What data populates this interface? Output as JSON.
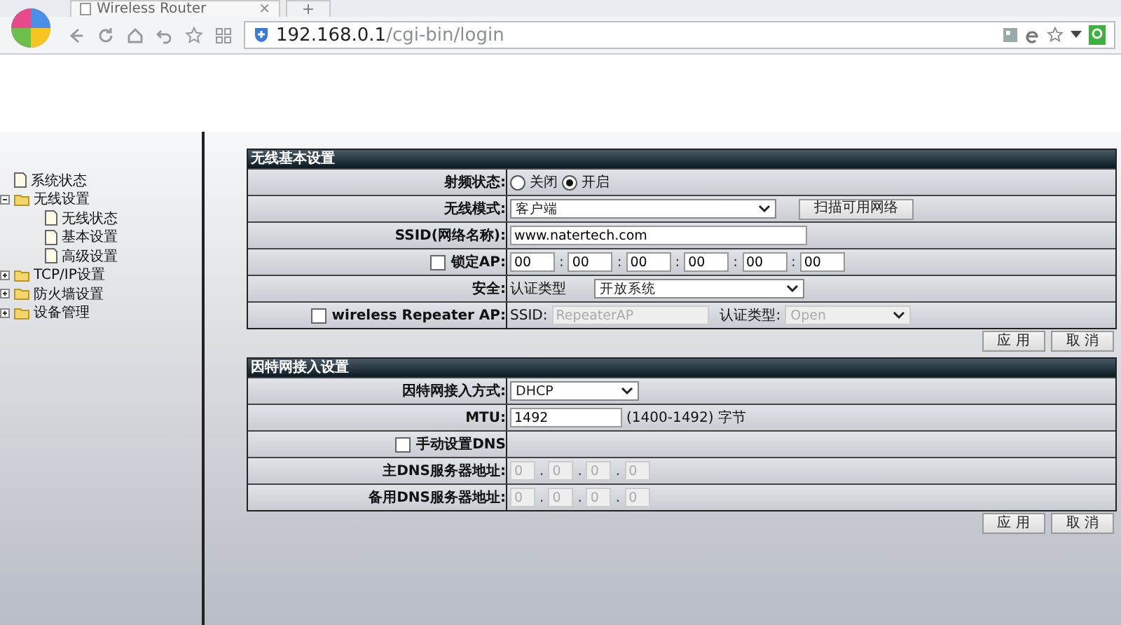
{
  "browser": {
    "tab_title": "Wireless Router",
    "tab_close": "×",
    "new_tab": "+",
    "url_host": "192.168.0.1",
    "url_path": "/cgi-bin/login"
  },
  "sidebar": {
    "items": [
      {
        "label": "系统状态",
        "kind": "page"
      },
      {
        "label": "无线设置",
        "kind": "folder",
        "expanded": true,
        "children": [
          {
            "label": "无线状态",
            "kind": "page"
          },
          {
            "label": "基本设置",
            "kind": "page"
          },
          {
            "label": "高级设置",
            "kind": "page"
          }
        ]
      },
      {
        "label": "TCP/IP设置",
        "kind": "folder",
        "expanded": false
      },
      {
        "label": "防火墙设置",
        "kind": "folder",
        "expanded": false
      },
      {
        "label": "设备管理",
        "kind": "folder",
        "expanded": false
      }
    ]
  },
  "sections": [
    {
      "title": "无线基本设置",
      "rows": [
        {
          "kind": "radio",
          "label": "射频状态:",
          "options": [
            {
              "label": "关闭",
              "selected": false
            },
            {
              "label": "开启",
              "selected": true
            }
          ]
        },
        {
          "kind": "select_button",
          "label": "无线模式:",
          "value": "客户端",
          "button": "扫描可用网络"
        },
        {
          "kind": "text",
          "label": "SSID(网络名称):",
          "value": "www.natertech.com"
        },
        {
          "kind": "mac",
          "label": "锁定AP:",
          "checked": false,
          "separator": ":",
          "values": [
            "00",
            "00",
            "00",
            "00",
            "00",
            "00"
          ]
        },
        {
          "kind": "select_label",
          "label": "安全:",
          "prefix": "认证类型",
          "value": "开放系统"
        },
        {
          "kind": "repeater",
          "label": "wireless Repeater AP:",
          "checked": false,
          "ssid_label": "SSID:",
          "ssid_value": "RepeaterAP",
          "auth_label": "认证类型:",
          "auth_value": "Open"
        }
      ],
      "buttons": [
        "应 用",
        "取 消"
      ]
    },
    {
      "title": "因特网接入设置",
      "rows": [
        {
          "kind": "select",
          "label": "因特网接入方式:",
          "value": "DHCP"
        },
        {
          "kind": "text",
          "label": "MTU:",
          "value": "1492",
          "suffix": "(1400-1492) 字节"
        },
        {
          "kind": "checkbox",
          "label": "手动设置DNS",
          "checked": false
        },
        {
          "kind": "ip",
          "label": "主DNS服务器地址:",
          "separator": ".",
          "values": [
            "0",
            "0",
            "0",
            "0"
          ]
        },
        {
          "kind": "ip",
          "label": "备用DNS服务器地址:",
          "separator": ".",
          "values": [
            "0",
            "0",
            "0",
            "0"
          ]
        }
      ],
      "buttons": [
        "应 用",
        "取 消"
      ]
    }
  ]
}
